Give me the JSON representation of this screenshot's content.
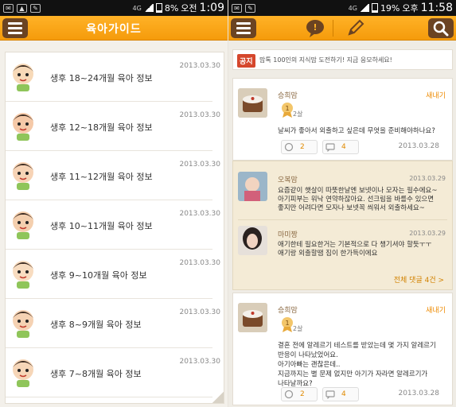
{
  "left": {
    "status": {
      "network": "4G",
      "battery": "8%",
      "ampm": "오전",
      "time": "1:09"
    },
    "title": "육아가이드",
    "items": [
      {
        "text": "생후 18~24개월 육아 정보",
        "date": "2013.03.30"
      },
      {
        "text": "생후 12~18개월 육아 정보",
        "date": "2013.03.30"
      },
      {
        "text": "생후 11~12개월 육아 정보",
        "date": "2013.03.30"
      },
      {
        "text": "생후 10~11개월 육아 정보",
        "date": "2013.03.30"
      },
      {
        "text": "생후 9~10개월 육아 정보",
        "date": "2013.03.30"
      },
      {
        "text": "생후 8~9개월 육아 정보",
        "date": "2013.03.30"
      },
      {
        "text": "생후 7~8개월 육아 정보",
        "date": "2013.03.30"
      }
    ]
  },
  "right": {
    "status": {
      "network": "4G",
      "battery": "19%",
      "ampm": "오후",
      "time": "11:58"
    },
    "notice": {
      "badge": "공지",
      "text": "맘톡 100인의 지식맘 도전하기! 지금 응모하세요!"
    },
    "posts": [
      {
        "name": "승희맘",
        "new": "새내기",
        "level": "2살",
        "body": "날씨가 좋아서 외출하고 싶은데 무엇을 준비해야하나요?",
        "likes": "2",
        "comments": "4",
        "date": "2013.03.28"
      },
      {
        "name": "승희맘",
        "new": "새내기",
        "level": "2살",
        "body": "결혼 전에 알레르기 테스트를 받았는데 몇 가지 알레르기\n반응이 나타났었어요.\n아기아빠는 괜찮은데..\n지금까지는 별 문제 없지만 아기가 자라면 알레르기가\n나타날까요?",
        "likes": "2",
        "comments": "4",
        "date": "2013.03.28"
      }
    ],
    "comments": [
      {
        "name": "오복맘",
        "date": "2013.03.29",
        "body": "요즘같이 햇살이 따뜻한날엔 보넷이나 모자는 필수에요~\n아기피부는 워낙 연약하잖아요. 선크림을 바를수 있으면\n좋지만 어려다면 모자나 보넷꼭 씌워서 외출하세요~"
      },
      {
        "name": "마미짱",
        "date": "2013.03.29",
        "body": "애기한테 필요한거는 기본적으로 다 챙기셔야 할듯ㅜㅜ\n애기랑 외출할땜 짐이 한가득이에요"
      }
    ],
    "all_comments": "전체 댓글 4건 >"
  },
  "colors": {
    "accent": "#f7a416",
    "menu_bg": "#6b4322",
    "notice_badge": "#d5472c"
  }
}
